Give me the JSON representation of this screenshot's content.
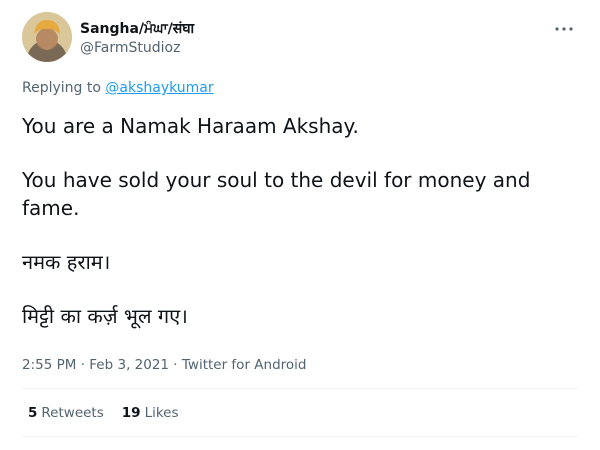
{
  "author": {
    "display_name": "Sangha/ਮੰਘਾ/संघा",
    "handle": "@FarmStudioz",
    "avatar": "profile-photo"
  },
  "reply": {
    "prefix": "Replying to ",
    "mention": "@akshaykumar"
  },
  "tweet": {
    "paragraphs": [
      "You are a Namak Haraam Akshay.",
      "You have sold your soul to the devil for money and fame.",
      "नमक हराम।",
      "मिट्टी का कर्ज़ भूल गए।"
    ]
  },
  "meta": {
    "time": "2:55 PM",
    "sep1": " · ",
    "date": "Feb 3, 2021",
    "sep2": " · ",
    "source": "Twitter for Android"
  },
  "stats": {
    "retweets_count": "5",
    "retweets_label": "Retweets",
    "likes_count": "19",
    "likes_label": "Likes"
  },
  "icons": {
    "more": "more-options-icon"
  },
  "colors": {
    "text": "#0f1419",
    "secondary": "#536471",
    "link": "#1d9bf0",
    "divider": "#eff3f4"
  }
}
